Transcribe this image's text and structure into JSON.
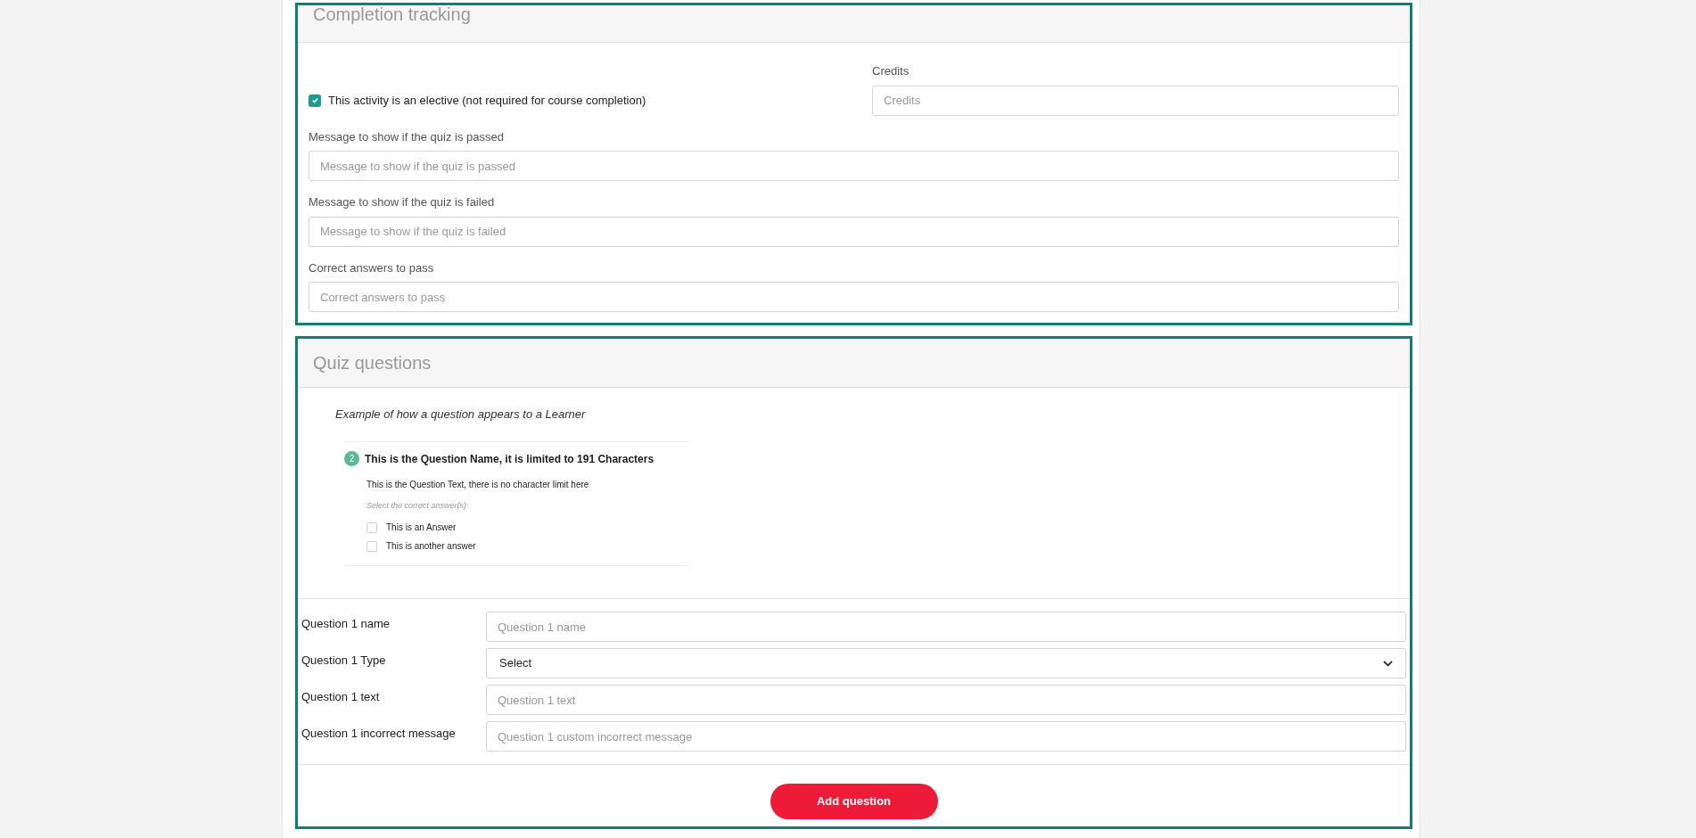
{
  "completion": {
    "title": "Completion tracking",
    "elective": {
      "label": "This activity is an elective (not required for course completion)",
      "checked": true
    },
    "credits": {
      "label": "Credits",
      "placeholder": "Credits"
    },
    "fields": [
      {
        "label": "Message to show if the quiz is passed",
        "placeholder": "Message to show if the quiz is passed"
      },
      {
        "label": "Message to show if the quiz is failed",
        "placeholder": "Message to show if the quiz is failed"
      },
      {
        "label": "Correct answers to pass",
        "placeholder": "Correct answers to pass"
      }
    ]
  },
  "quiz": {
    "title": "Quiz questions",
    "example": {
      "caption": "Example of how a question appears to a Learner",
      "number": "2",
      "name": "This is the Question Name, it is limited to 191 Characters",
      "text": "This is the Question Text, there is no character limit here",
      "instruction": "Select the correct answer(s):",
      "answers": [
        {
          "label": "This is an Answer",
          "checked": false
        },
        {
          "label": "This is another answer",
          "checked": false
        }
      ]
    },
    "rows": [
      {
        "kind": "input",
        "label": "Question 1 name",
        "placeholder": "Question 1 name"
      },
      {
        "kind": "select",
        "label": "Question 1 Type",
        "value": "Select"
      },
      {
        "kind": "input",
        "label": "Question 1 text",
        "placeholder": "Question 1 text"
      },
      {
        "kind": "input",
        "label": "Question 1 incorrect message",
        "placeholder": "Question 1 custom incorrect message"
      }
    ],
    "button": "Add question"
  }
}
